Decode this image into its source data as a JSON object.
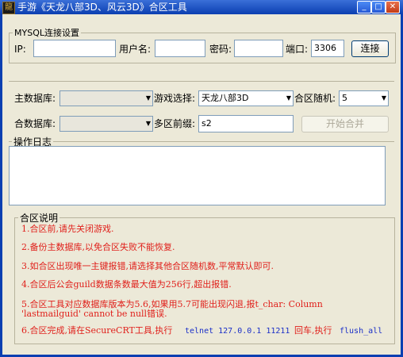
{
  "window": {
    "title": "手游《天龙八部3D、风云3D》合区工具",
    "app_icon_glyph": "龍"
  },
  "mysql": {
    "group_title": "MYSQL连接设置",
    "ip_label": "IP:",
    "ip_value": "",
    "user_label": "用户名:",
    "user_value": "",
    "password_label": "密码:",
    "password_value": "",
    "port_label": "端口:",
    "port_value": "3306",
    "connect_button": "连接"
  },
  "merge": {
    "main_db_label": "主数据库:",
    "main_db_value": "",
    "game_label": "游戏选择:",
    "game_value": "天龙八部3D",
    "random_label": "合区随机:",
    "random_value": "5",
    "merge_db_label": "合数据库:",
    "merge_db_value": "",
    "prefix_label": "多区前缀:",
    "prefix_value": "s2",
    "start_button": "开始合并"
  },
  "log": {
    "group_title": "操作日志",
    "content": ""
  },
  "notes": {
    "group_title": "合区说明",
    "items": [
      "1.合区前,请先关闭游戏.",
      "2.备份主数据库,以免合区失败不能恢复.",
      "3.如合区出现唯一主键报错,请选择其他合区随机数,平常默认即可.",
      "4.合区后公会guild数据条数最大值为256行,超出报错.",
      "5.合区工具对应数据库版本为5.6,如果用5.7可能出现闪退,报t_char: Column",
      "'lastmailguid' cannot be null错误.",
      "6.合区完成,请在SecureCRT工具,执行"
    ],
    "command_1": "telnet 127.0.0.1 11211",
    "command_mid": "回车,执行",
    "command_2": "flush_all"
  },
  "colors": {
    "note_red": "#e0201b",
    "command_blue": "#1a2fc8",
    "titlebar": "#0b3fb1"
  }
}
